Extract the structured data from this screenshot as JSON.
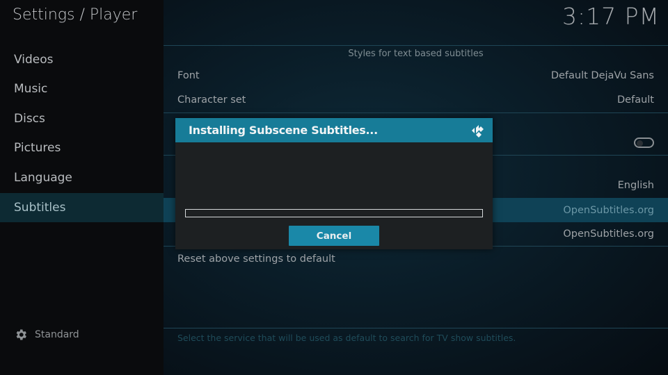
{
  "header": {
    "title": "Settings / Player",
    "clock": "3:17 PM"
  },
  "sidebar": {
    "items": [
      {
        "label": "Videos"
      },
      {
        "label": "Music"
      },
      {
        "label": "Discs"
      },
      {
        "label": "Pictures"
      },
      {
        "label": "Language"
      },
      {
        "label": "Subtitles",
        "active": true
      }
    ],
    "level": {
      "icon": "gear-icon",
      "label": "Standard"
    }
  },
  "main": {
    "group_title": "Styles for text based subtitles",
    "rows": [
      {
        "label": "Font",
        "value": "Default DejaVu Sans"
      },
      {
        "label": "Character set",
        "value": "Default"
      },
      {
        "label": "",
        "value": "",
        "toggle": false
      },
      {
        "label": "",
        "value": "English"
      },
      {
        "label": "",
        "value": "OpenSubtitles.org",
        "focused": true
      },
      {
        "label": "",
        "value": "OpenSubtitles.org"
      },
      {
        "label": "Reset above settings to default",
        "value": ""
      }
    ],
    "hint": "Select the service that will be used as default to search for TV show subtitles."
  },
  "dialog": {
    "title": "Installing Subscene Subtitles...",
    "icon": "kodi-logo-icon",
    "progress_percent": 0,
    "cancel_label": "Cancel"
  },
  "colors": {
    "accent": "#177c98",
    "focus_row": "#0f4256",
    "sidebar_active": "#0d2a33"
  }
}
